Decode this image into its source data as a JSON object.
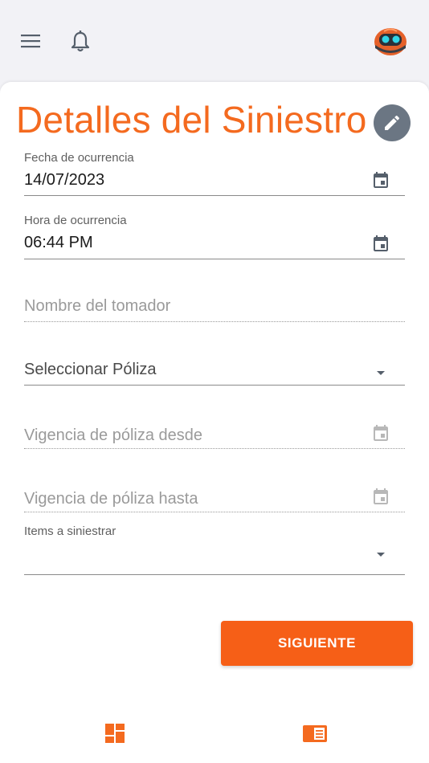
{
  "header": {
    "menu_icon": "hamburger-menu-icon",
    "notifications_icon": "bell-icon",
    "avatar_icon": "robot-avatar-icon"
  },
  "main": {
    "title": "Detalles del Siniestro",
    "edit_icon": "pencil-icon",
    "fields": {
      "fecha": {
        "label": "Fecha de ocurrencia",
        "value": "14/07/2023",
        "icon": "calendar-icon"
      },
      "hora": {
        "label": "Hora de ocurrencia",
        "value": "06:44 PM",
        "icon": "calendar-icon"
      },
      "tomador": {
        "placeholder": "Nombre del tomador"
      },
      "poliza": {
        "value": "Seleccionar Póliza",
        "icon": "dropdown-arrow-icon"
      },
      "vigencia_desde": {
        "placeholder": "Vigencia de póliza desde",
        "icon": "calendar-icon"
      },
      "vigencia_hasta": {
        "placeholder": "Vigencia de póliza hasta",
        "icon": "calendar-icon"
      },
      "items": {
        "label": "Items a siniestrar",
        "value": "",
        "icon": "dropdown-arrow-icon"
      }
    },
    "next_button": "SIGUIENTE"
  },
  "bottom_nav": [
    {
      "icon": "dashboard-icon"
    },
    {
      "icon": "document-list-icon"
    }
  ],
  "colors": {
    "accent": "#f46a1f",
    "button": "#f65f17",
    "edit_button": "#6b7683",
    "icon_gray": "#555f6b"
  }
}
